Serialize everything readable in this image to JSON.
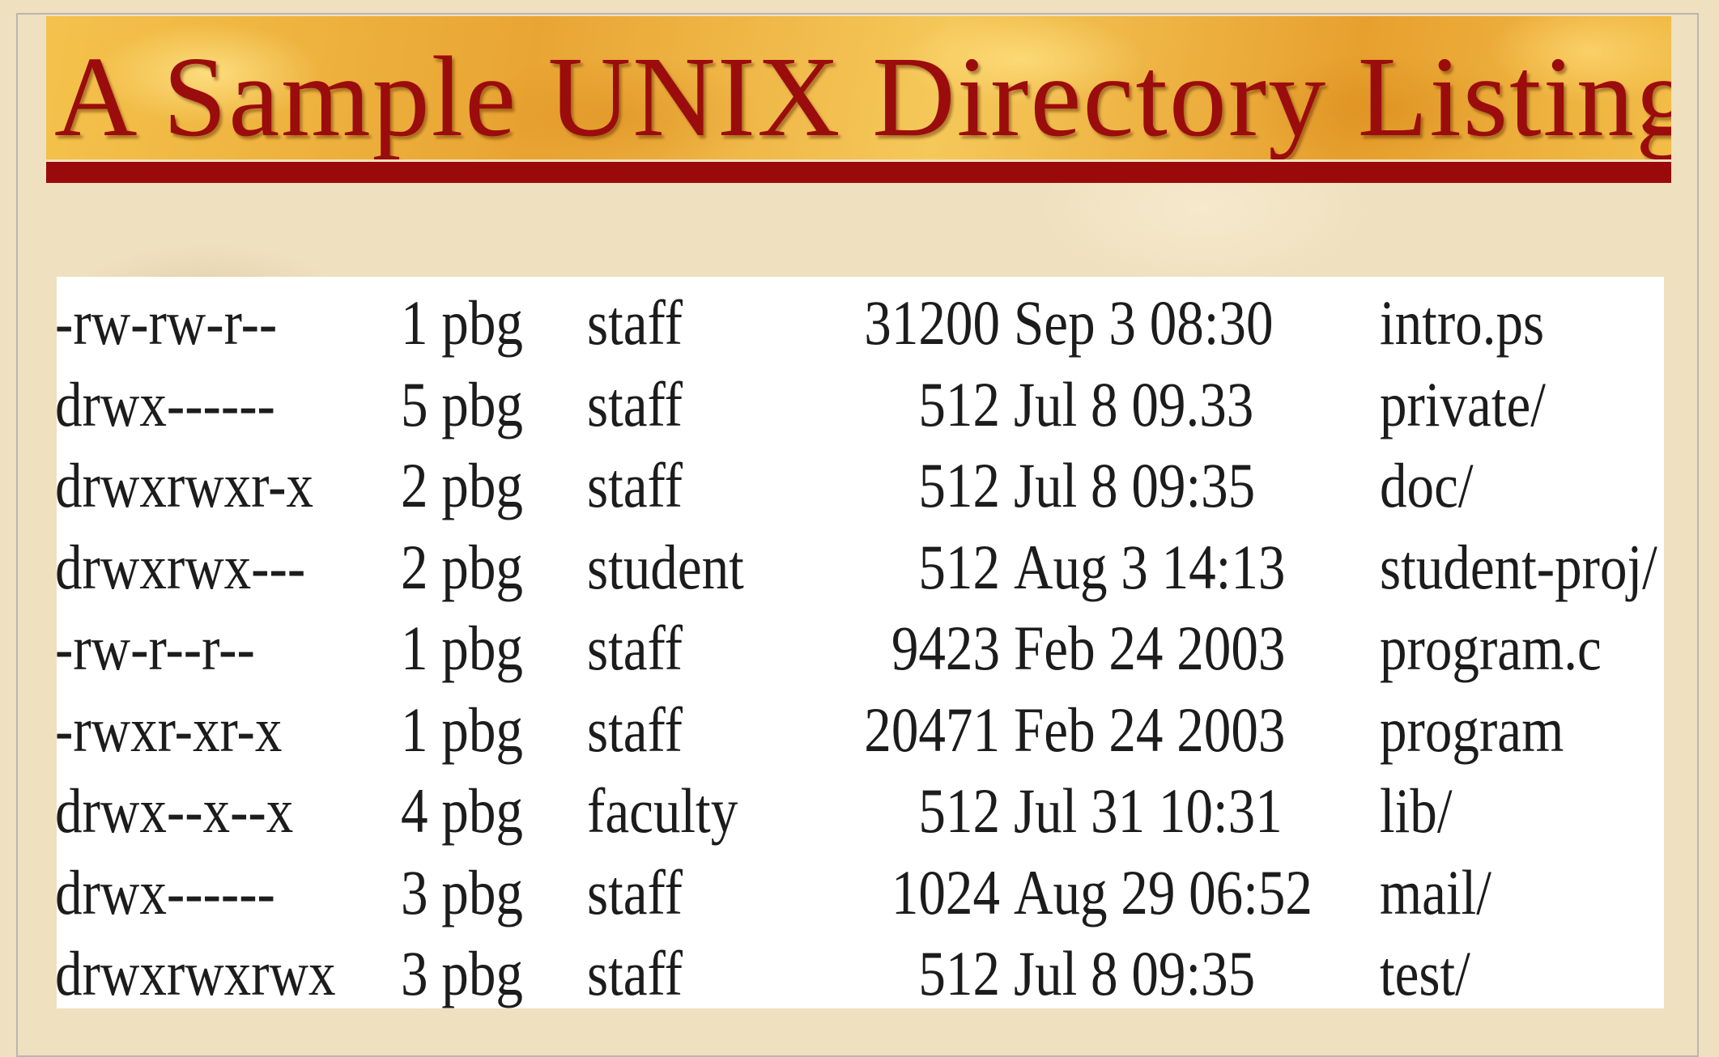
{
  "title": "A Sample UNIX Directory Listing",
  "colors": {
    "title_text": "#9b0c0c",
    "title_rule": "#9a0a0a",
    "banner": "#f0b43a",
    "background": "#efe0bf",
    "listing_background": "#ffffff"
  },
  "listing": [
    {
      "permissions": "-rw-rw-r--",
      "links_owner": "1 pbg",
      "group": "staff",
      "size": "31200",
      "date": "Sep 3 08:30",
      "name": "intro.ps"
    },
    {
      "permissions": "drwx------",
      "links_owner": "5 pbg",
      "group": "staff",
      "size": "512",
      "date": "Jul 8 09.33",
      "name": "private/"
    },
    {
      "permissions": "drwxrwxr-x",
      "links_owner": "2 pbg",
      "group": "staff",
      "size": "512",
      "date": "Jul 8 09:35",
      "name": "doc/"
    },
    {
      "permissions": "drwxrwx---",
      "links_owner": "2 pbg",
      "group": "student",
      "size": "512",
      "date": "Aug 3 14:13",
      "name": "student-proj/"
    },
    {
      "permissions": "-rw-r--r--",
      "links_owner": "1 pbg",
      "group": "staff",
      "size": "9423",
      "date": "Feb 24 2003",
      "name": "program.c"
    },
    {
      "permissions": "-rwxr-xr-x",
      "links_owner": "1 pbg",
      "group": "staff",
      "size": "20471",
      "date": "Feb 24 2003",
      "name": "program"
    },
    {
      "permissions": "drwx--x--x",
      "links_owner": "4 pbg",
      "group": "faculty",
      "size": "512",
      "date": "Jul 31 10:31",
      "name": "lib/"
    },
    {
      "permissions": "drwx------",
      "links_owner": "3 pbg",
      "group": "staff",
      "size": "1024",
      "date": "Aug 29 06:52",
      "name": "mail/"
    },
    {
      "permissions": "drwxrwxrwx",
      "links_owner": "3 pbg",
      "group": "staff",
      "size": "512",
      "date": "Jul 8 09:35",
      "name": "test/"
    }
  ]
}
